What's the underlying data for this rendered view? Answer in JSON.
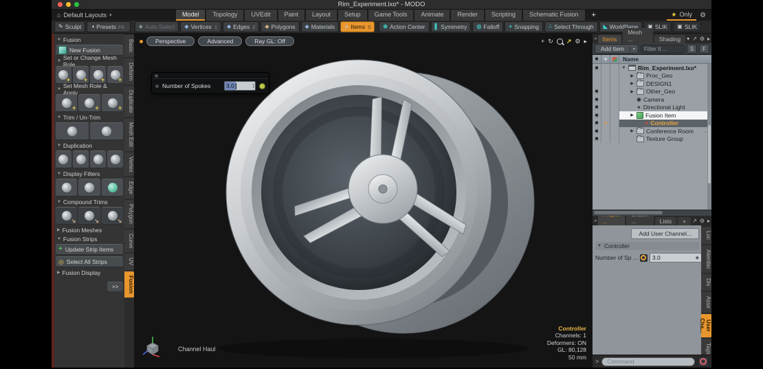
{
  "window": {
    "title": "Rim_Experiment.lxo* - MODO"
  },
  "menubar": {
    "layout_icon": "layout-preset-icon",
    "layout_switcher": "Default Layouts",
    "tabs": [
      "Model",
      "Topology",
      "UVEdit",
      "Paint",
      "Layout",
      "Setup",
      "Game Tools",
      "Animate",
      "Render",
      "Scripting",
      "Schematic Fusion"
    ],
    "active_tab": "Model",
    "add_tab": "+",
    "star": "★",
    "only": "Only"
  },
  "toolbar": {
    "left": [
      {
        "label": "Sculpt",
        "icon": "pen-icon"
      },
      {
        "label": "Presets",
        "suffix": "F6",
        "icon": "sphere-icon"
      }
    ],
    "selection": [
      {
        "label": "Auto Select",
        "icon": "cube-gray-icon",
        "disabled": true
      },
      {
        "label": "Vertices",
        "badge": "1",
        "icon": "cube-blue-icon"
      },
      {
        "label": "Edges",
        "badge": "2",
        "icon": "cube-blue-icon"
      },
      {
        "label": "Polygons",
        "icon": "cube-tan-icon"
      },
      {
        "label": "Materials",
        "icon": "cube-blue-icon"
      },
      {
        "label": "Items",
        "badge": "5",
        "icon": "cube-tan-icon",
        "active": true
      }
    ],
    "tools": [
      {
        "label": "Action Center",
        "icon": "target-icon"
      },
      {
        "label": "Symmetry",
        "icon": "symmetry-icon"
      },
      {
        "label": "Falloff",
        "icon": "falloff-icon"
      },
      {
        "label": "Snapping",
        "icon": "snap-plus-icon"
      },
      {
        "label": "Select Through",
        "icon": "select-through-icon"
      },
      {
        "label": "WorkPlane",
        "icon": "workplane-icon"
      },
      {
        "label": "SLIK",
        "icon": "slik-icon",
        "chip": true
      },
      {
        "label": "SLIK",
        "icon": "slik-icon",
        "chip": true
      }
    ]
  },
  "sidebar": {
    "vertical_tabs": [
      "Basic",
      "Deform",
      "Duplicate",
      "Mesh Edit",
      "Vertex",
      "Edge",
      "Polygon",
      "Curve",
      "UV",
      "Fusion"
    ],
    "active_vertical_tab": "Fusion",
    "sections": [
      {
        "type": "header",
        "label": "Fusion",
        "expanded": true
      },
      {
        "type": "button",
        "label": "New Fusion",
        "icon": "new-fusion-icon"
      },
      {
        "type": "header",
        "label": "Set or Change Mesh Role",
        "expanded": true
      },
      {
        "type": "icons",
        "count": 4,
        "accent": "plus",
        "group": "set-mesh-role"
      },
      {
        "type": "header",
        "label": "Set Mesh Role & Apply",
        "expanded": true
      },
      {
        "type": "icons",
        "count": 3,
        "accent": "plus",
        "group": "mesh-role-apply"
      },
      {
        "type": "header",
        "label": "Trim / Un-Trim",
        "expanded": true
      },
      {
        "type": "icons",
        "count": 2,
        "accent": "none",
        "group": "trim"
      },
      {
        "type": "header",
        "label": "Duplication",
        "expanded": true
      },
      {
        "type": "icons",
        "count": 4,
        "accent": "none",
        "group": "duplication"
      },
      {
        "type": "header",
        "label": "Display Filters",
        "expanded": true
      },
      {
        "type": "icons",
        "count": 3,
        "accent": "filter",
        "group": "display-filters"
      },
      {
        "type": "header",
        "label": "Compound Trims",
        "expanded": true
      },
      {
        "type": "icons",
        "count": 3,
        "accent": "compound",
        "group": "compound-trims"
      },
      {
        "type": "header",
        "label": "Fusion Meshes",
        "expanded": false
      },
      {
        "type": "header",
        "label": "Fusion Strips",
        "expanded": true
      },
      {
        "type": "button",
        "label": "Update Strip Items",
        "icon": "update-strips-icon"
      },
      {
        "type": "button",
        "label": "Select All Strips",
        "icon": "select-strips-icon"
      },
      {
        "type": "header",
        "label": "Fusion Display",
        "expanded": false
      },
      {
        "type": "more",
        "label": ">>"
      }
    ]
  },
  "viewport": {
    "buttons": [
      "Perspective",
      "Advanced",
      "Ray GL: Off"
    ],
    "nav_icons": [
      "pan-icon",
      "orbit-icon",
      "zoom-icon",
      "maximize-icon",
      "gear-icon",
      "arrow-icon"
    ],
    "spokes_dialog": {
      "label": "Number of Spokes",
      "value": "3.0"
    },
    "axis_label": "Channel Haul",
    "hud": {
      "item": "Controller",
      "channels": "Channels: 1",
      "deformers": "Deformers: ON",
      "gl": "GL: 80,128",
      "grid": "50 mm"
    }
  },
  "items_panel": {
    "tabs": [
      "Items",
      "Mesh ...",
      "Shading"
    ],
    "active_tab": "Items",
    "add_item": "Add Item",
    "filter_placeholder": "Filter It ...",
    "mini_buttons": [
      "S",
      "F"
    ],
    "name_header": "Name",
    "tree": [
      {
        "label": "Rim_Experiment.lxo*",
        "depth": 0,
        "arrow": "down",
        "icon": "scene-icon",
        "eye": true,
        "bold": true
      },
      {
        "label": "Proc_Geo",
        "depth": 1,
        "arrow": "right",
        "icon": "folder-icon",
        "eye": false
      },
      {
        "label": "DESIGN1",
        "depth": 1,
        "arrow": "right",
        "icon": "folder-icon",
        "eye": false
      },
      {
        "label": "Other_Geo",
        "depth": 1,
        "arrow": "right",
        "icon": "folder-icon",
        "eye": true
      },
      {
        "label": "Camera",
        "depth": 1,
        "arrow": "none",
        "icon": "camera-icon",
        "eye": true
      },
      {
        "label": "Directional Light",
        "depth": 1,
        "arrow": "none",
        "icon": "light-icon",
        "eye": true
      },
      {
        "label": "Fusion Item",
        "depth": 1,
        "arrow": "right",
        "icon": "fusion-icon",
        "eye": true,
        "selected": true
      },
      {
        "label": "Controller",
        "depth": 2,
        "arrow": "none",
        "icon": "locator-icon",
        "eye": true,
        "controller": true,
        "plus": true
      },
      {
        "label": "Conference Room",
        "depth": 1,
        "arrow": "right",
        "icon": "folder-icon",
        "eye": true,
        "suffix": "..."
      },
      {
        "label": "Texture Group",
        "depth": 1,
        "arrow": "none",
        "icon": "folder-icon",
        "eye": true
      }
    ]
  },
  "properties_panel": {
    "tabs": [
      "Proper ...",
      "Chann ...",
      "Lists"
    ],
    "active_tab": "Proper ...",
    "add_tab": "+",
    "add_user_channel": "Add User Channel...",
    "section": "Controller",
    "field": {
      "label": "Number of Sp ...",
      "value": "3.0"
    },
    "vertical_tabs": [
      "Loc ...",
      "Alembic ...",
      "Dis ...",
      "Asse ...",
      "User Cha...",
      "Tags"
    ],
    "active_vertical_tab": "User Cha..."
  },
  "command_bar": {
    "prompt": ">",
    "placeholder": "Command"
  },
  "colors": {
    "accent": "#e8962e",
    "hud_highlight": "#e8b64a",
    "record": "#e06070",
    "selection_blue": "#7288b8",
    "viewport_bg": "#49505 6"
  }
}
